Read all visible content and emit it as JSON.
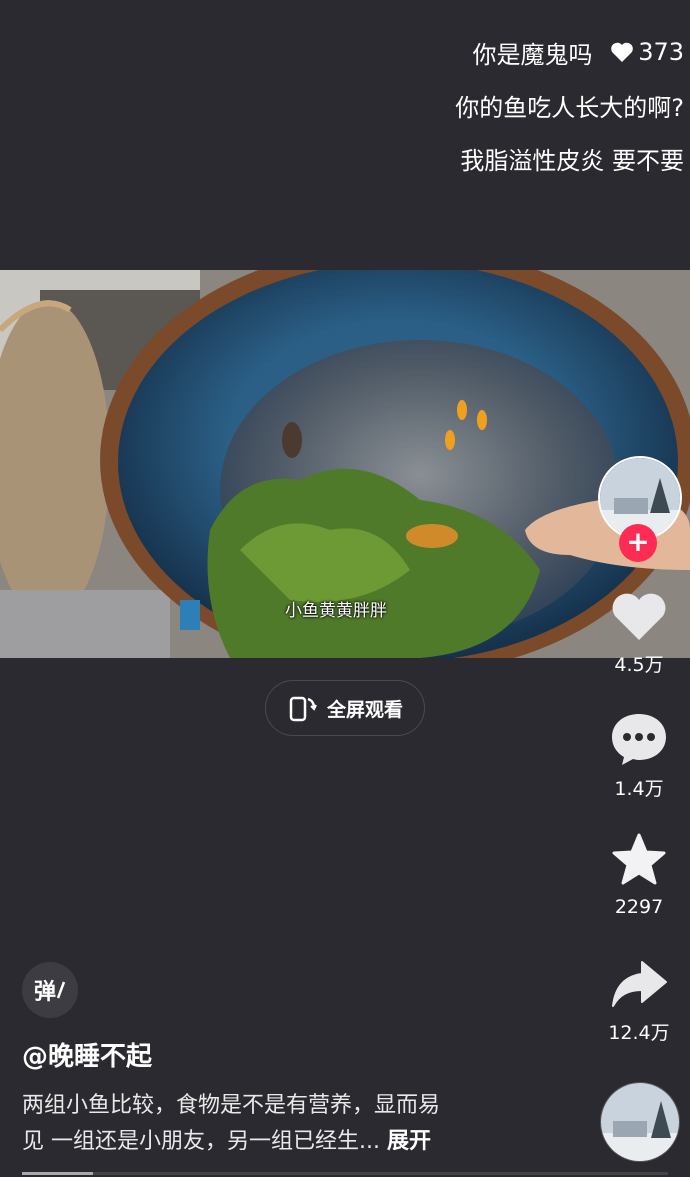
{
  "comments": [
    {
      "text": "你是魔鬼吗",
      "likes": "373"
    },
    {
      "text": "你的鱼吃人长大的啊?"
    },
    {
      "text": "我脂溢性皮炎 要不要"
    }
  ],
  "video": {
    "caption": "小鱼黄黄胖胖"
  },
  "fullscreen_label": "全屏观看",
  "actions": {
    "like_count": "4.5万",
    "comment_count": "1.4万",
    "favorite_count": "2297",
    "share_count": "12.4万"
  },
  "danmaku_label": "弹",
  "author": "@晚睡不起",
  "description": {
    "line1": "两组小鱼比较，食物是不是有营养，显而易",
    "line2": "见 一组还是小朋友，另一组已经生...",
    "expand": "展开"
  },
  "playback_progress": 0.11,
  "colors": {
    "background": "#2b2a30",
    "follow_accent": "#fe2c55"
  }
}
